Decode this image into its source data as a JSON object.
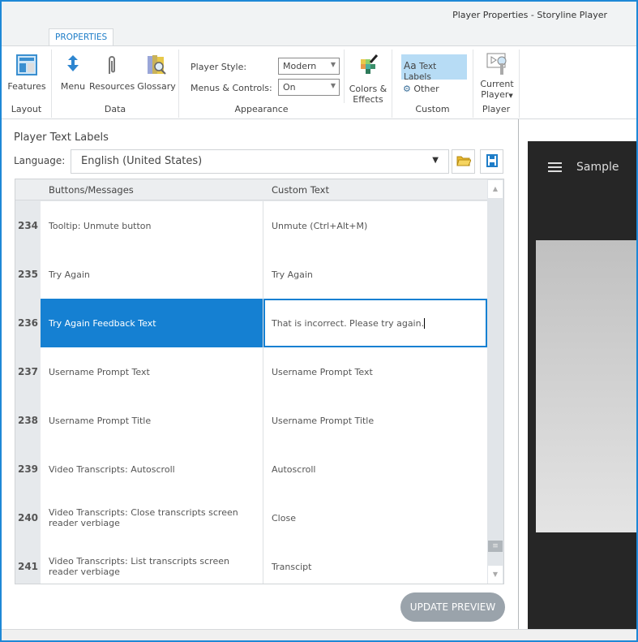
{
  "window": {
    "title": "Player Properties - Storyline Player"
  },
  "ribbon": {
    "tab": "PROPERTIES",
    "groups": {
      "layout": "Layout",
      "data": "Data",
      "appearance": "Appearance",
      "custom": "Custom",
      "player": "Player"
    },
    "buttons": {
      "features": "Features",
      "menu": "Menu",
      "resources": "Resources",
      "glossary": "Glossary",
      "colors_effects_1": "Colors &",
      "colors_effects_2": "Effects",
      "text_labels": "Text Labels",
      "text_labels_icon": "Aa",
      "other": "Other",
      "current_player_1": "Current",
      "current_player_2": "Player"
    },
    "player_style": {
      "label": "Player Style:",
      "value": "Modern"
    },
    "menus_controls": {
      "label": "Menus & Controls:",
      "value": "On"
    }
  },
  "panel": {
    "heading": "Player Text Labels",
    "language_label": "Language:",
    "language_value": "English (United States)",
    "columns": [
      "Buttons/Messages",
      "Custom Text"
    ],
    "rows": [
      {
        "num": "234",
        "name": "Tooltip: Unmute button",
        "text": "Unmute (Ctrl+Alt+M)"
      },
      {
        "num": "235",
        "name": "Try Again",
        "text": "Try Again"
      },
      {
        "num": "236",
        "name": "Try Again Feedback Text",
        "text": "That is incorrect. Please try again."
      },
      {
        "num": "237",
        "name": "Username Prompt Text",
        "text": "Username Prompt Text"
      },
      {
        "num": "238",
        "name": "Username Prompt Title",
        "text": "Username Prompt Title"
      },
      {
        "num": "239",
        "name": "Video Transcripts: Autoscroll",
        "text": "Autoscroll"
      },
      {
        "num": "240",
        "name": "Video Transcripts: Close transcripts screen reader verbiage",
        "text": "Close"
      },
      {
        "num": "241",
        "name": "Video Transcripts: List transcripts screen reader verbiage",
        "text": "Transcipt"
      }
    ],
    "update_button": "UPDATE PREVIEW"
  },
  "preview": {
    "title": "Sample"
  },
  "colors": {
    "accent": "#1580d2",
    "selected_bg": "#b7dcf5"
  }
}
